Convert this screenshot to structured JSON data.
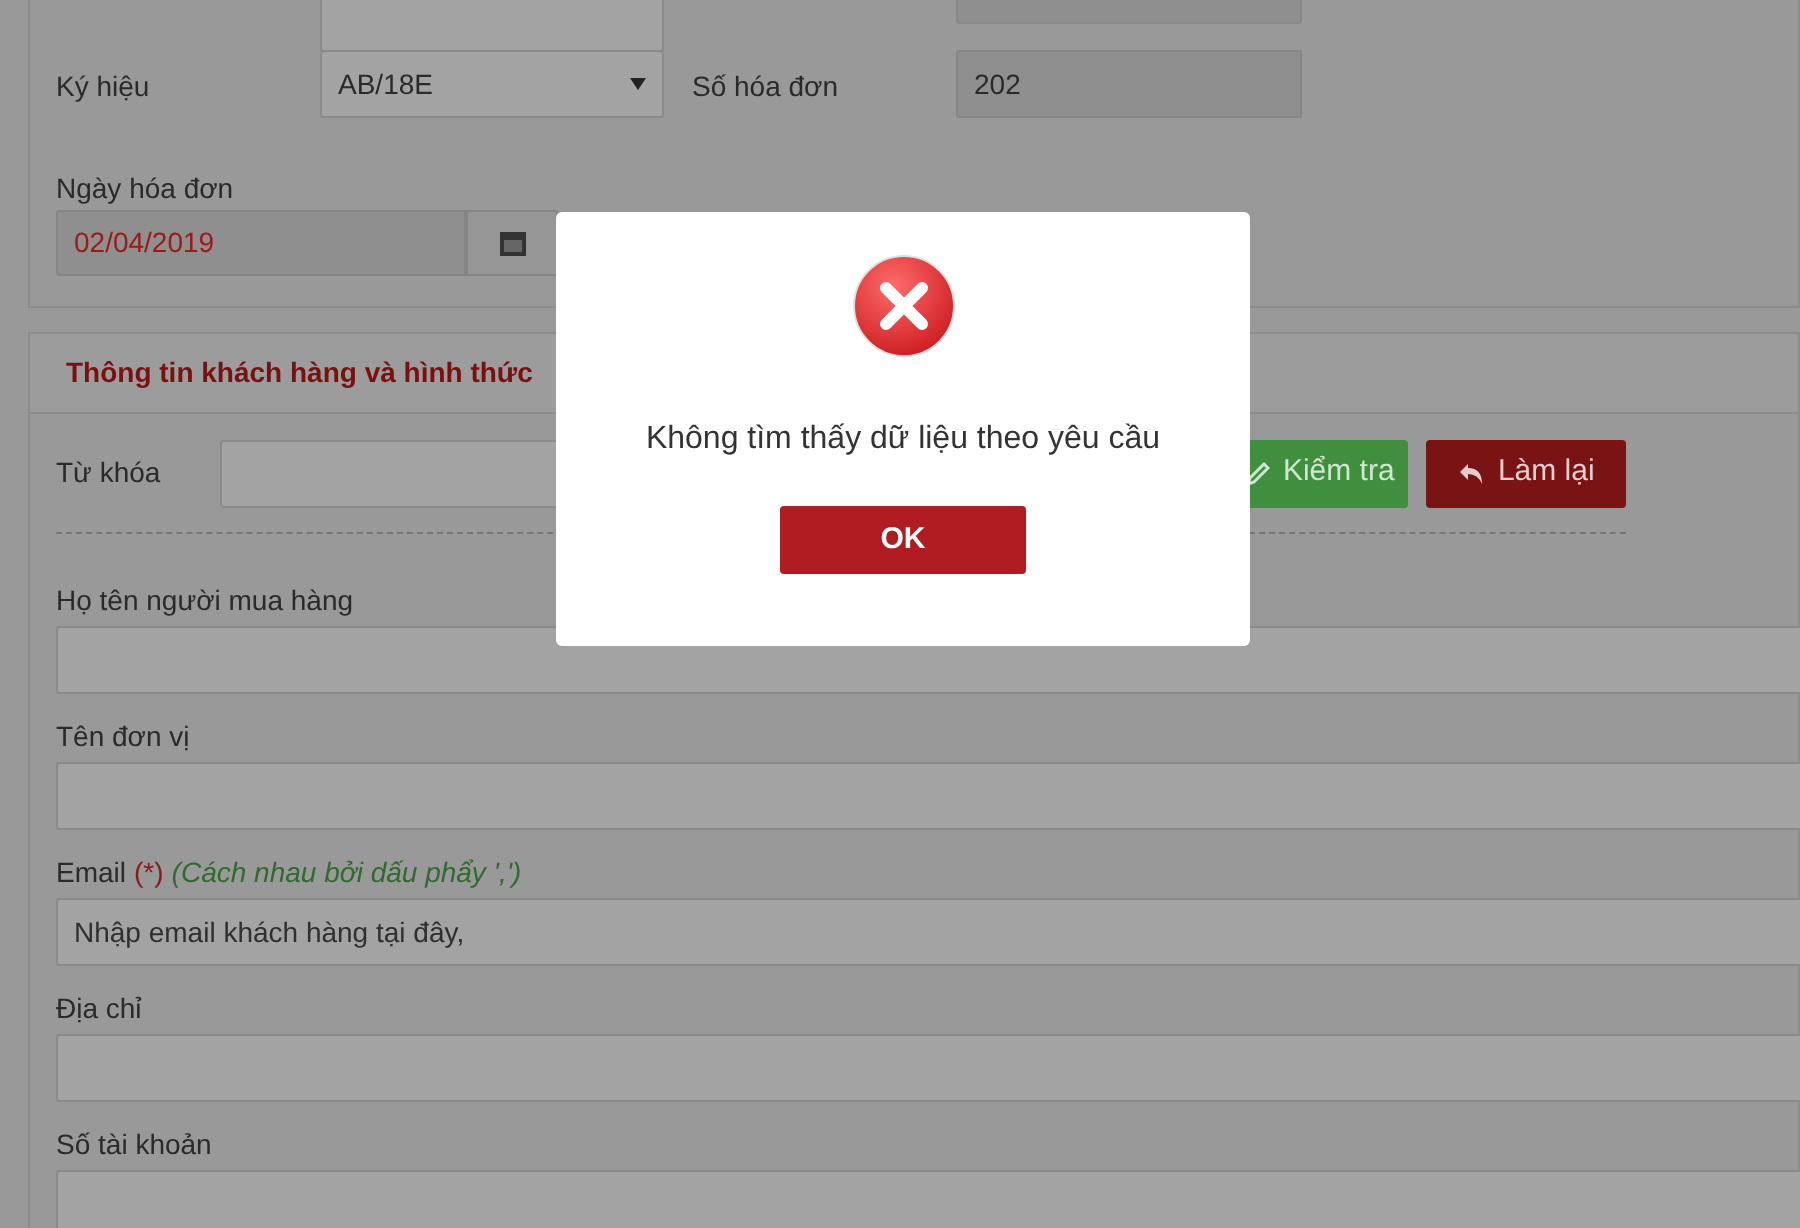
{
  "invoice": {
    "symbol_label": "Ký hiệu",
    "symbol_value": "AB/18E",
    "number_label": "Số hóa đơn",
    "number_value": "202",
    "date_label": "Ngày hóa đơn",
    "date_value": "02/04/2019"
  },
  "customer_panel": {
    "title": "Thông tin khách hàng và hình thức",
    "keyword_label": "Từ khóa",
    "buttons": [
      {
        "label": "Kiểm tra",
        "kind": "check"
      },
      {
        "label": "Làm lại",
        "kind": "reset"
      }
    ],
    "fields": [
      {
        "label": "Họ tên người mua hàng"
      },
      {
        "label": "Tên đơn vị"
      },
      {
        "label": "Email",
        "required_mark": "(*)",
        "hint": "(Cách nhau bởi dấu phẩy ',')",
        "placeholder": "Nhập email khách hàng tại đây,"
      },
      {
        "label": "Địa chỉ"
      },
      {
        "label": "Số tài khoản"
      }
    ]
  },
  "dialog": {
    "message": "Không tìm thấy dữ liệu theo yêu cầu",
    "button": "OK"
  }
}
